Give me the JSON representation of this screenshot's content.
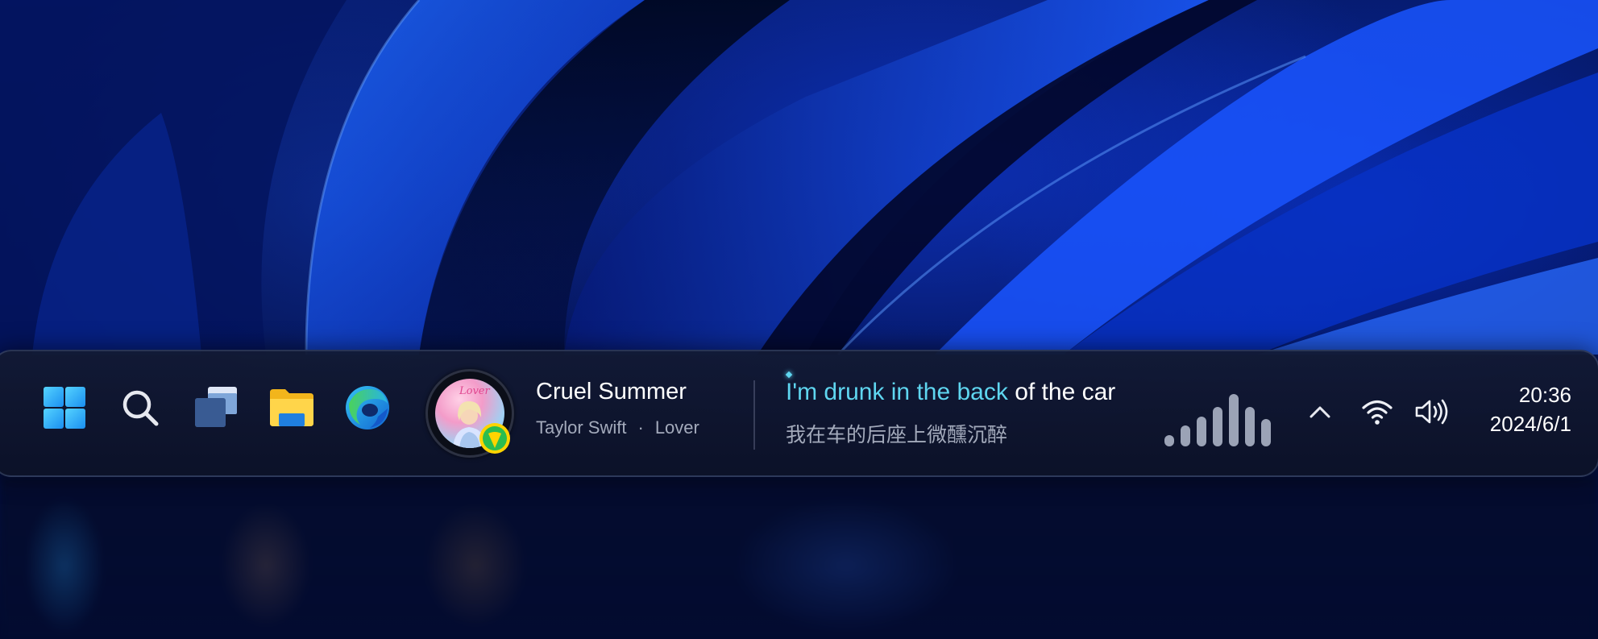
{
  "taskbar": {
    "pinned_icons": [
      "windows-start-icon",
      "search-icon",
      "task-view-icon",
      "file-explorer-icon",
      "edge-browser-icon"
    ]
  },
  "now_playing": {
    "title": "Cruel Summer",
    "artist": "Taylor Swift",
    "separator": "·",
    "album": "Lover",
    "album_art_script": "Lover",
    "app_badge_icon": "qq-music-icon",
    "lyric_sung": "I'm drunk in the back",
    "lyric_unsung": " of the car",
    "lyric_translation": "我在车的后座上微醺沉醉",
    "lyric_highlight_color": "#5fd6f0",
    "visualizer_levels": [
      0.2,
      0.38,
      0.55,
      0.72,
      0.95,
      0.72,
      0.5
    ]
  },
  "tray": {
    "icons": [
      "chevron-up-icon",
      "wifi-icon",
      "volume-icon"
    ]
  },
  "clock": {
    "time": "20:36",
    "date": "2024/6/1"
  }
}
